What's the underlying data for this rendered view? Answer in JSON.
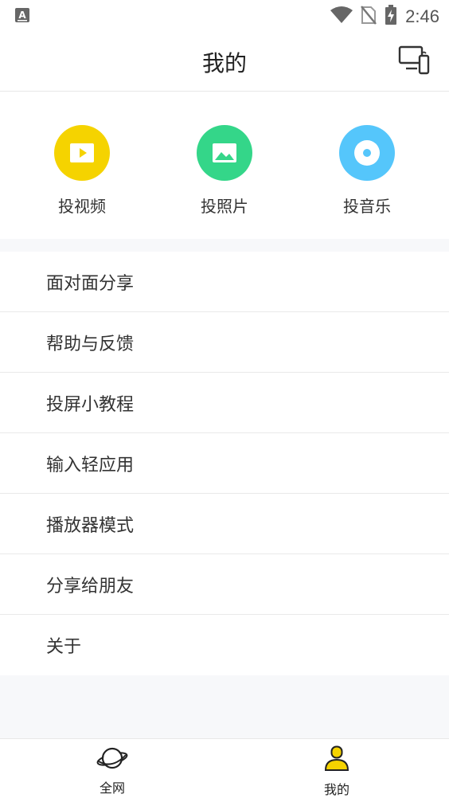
{
  "status_bar": {
    "time": "2:46"
  },
  "header": {
    "title": "我的"
  },
  "quick_actions": [
    {
      "label": "投视频",
      "color": "#f5d300",
      "icon": "play-video-icon"
    },
    {
      "label": "投照片",
      "color": "#34d689",
      "icon": "image-icon"
    },
    {
      "label": "投音乐",
      "color": "#55c6fb",
      "icon": "music-disc-icon"
    }
  ],
  "menu": {
    "items": [
      {
        "label": "面对面分享"
      },
      {
        "label": "帮助与反馈"
      },
      {
        "label": "投屏小教程"
      },
      {
        "label": "输入轻应用"
      },
      {
        "label": "播放器模式"
      },
      {
        "label": "分享给朋友"
      },
      {
        "label": "关于"
      }
    ]
  },
  "bottom_nav": {
    "items": [
      {
        "label": "全网",
        "icon": "planet-icon"
      },
      {
        "label": "我的",
        "icon": "user-icon",
        "active": true
      }
    ]
  },
  "colors": {
    "accent_yellow": "#f5d300",
    "green": "#34d689",
    "blue": "#55c6fb"
  }
}
